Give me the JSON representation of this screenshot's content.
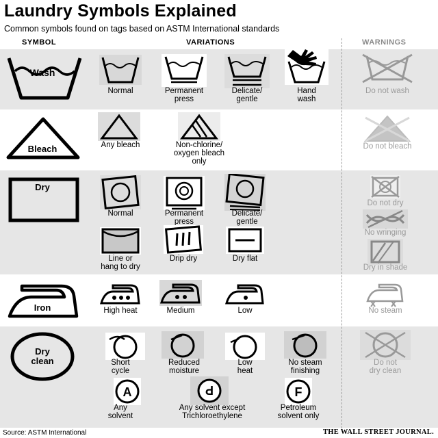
{
  "title": "Laundry Symbols Explained",
  "subtitle": "Common symbols found on tags based on ASTM International standards",
  "columns": {
    "symbol": "SYMBOL",
    "variations": "VARIATIONS",
    "warnings": "WARNINGS"
  },
  "wash": {
    "symbol_label": "Wash",
    "variations": [
      "Normal",
      "Permanent press",
      "Delicate/ gentle",
      "Hand wash"
    ],
    "warning": "Do not wash"
  },
  "bleach": {
    "symbol_label": "Bleach",
    "variations": [
      "Any bleach",
      "Non-chlorine/ oxygen bleach only"
    ],
    "warning": "Do not bleach"
  },
  "dry": {
    "symbol_label": "Dry",
    "variations": [
      "Normal",
      "Permanent press",
      "Delicate/ gentle",
      "Line or hang to dry",
      "Drip dry",
      "Dry flat"
    ],
    "warnings": [
      "Do not dry",
      "No wringing",
      "Dry in shade"
    ]
  },
  "iron": {
    "symbol_label": "Iron",
    "variations": [
      "High heat",
      "Medium",
      "Low"
    ],
    "warning": "No steam"
  },
  "dryclean": {
    "symbol_label": "Dry clean",
    "variations": [
      "Short cycle",
      "Reduced moisture",
      "Low heat",
      "No steam finishing",
      "Any solvent",
      "Any solvent except Trichloroethylene",
      "Petroleum solvent only"
    ],
    "letters": [
      "A",
      "P",
      "F"
    ],
    "warning": "Do not dry clean"
  },
  "footer": {
    "source": "Source: ASTM International",
    "publisher": "THE WALL STREET JOURNAL."
  }
}
